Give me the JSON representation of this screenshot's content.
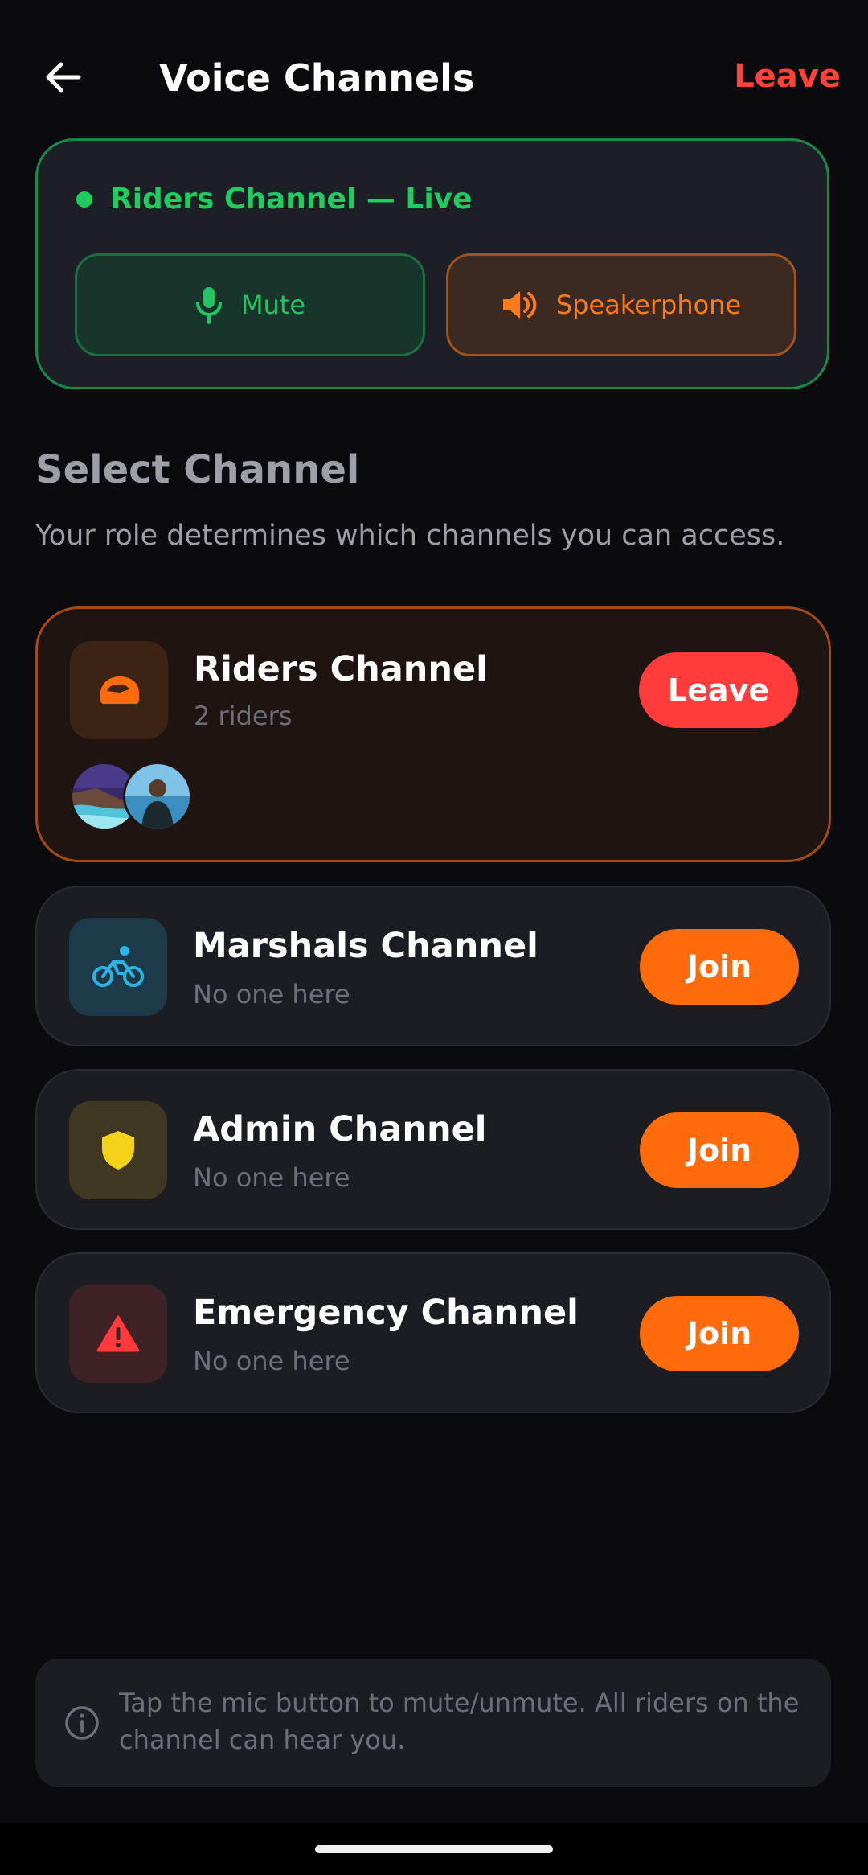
{
  "header": {
    "title": "Voice Channels",
    "leave_label": "Leave"
  },
  "live": {
    "status_text": "Riders Channel — Live",
    "mute_label": "Mute",
    "speaker_label": "Speakerphone"
  },
  "section": {
    "title": "Select Channel",
    "subtitle": "Your role determines which channels you can access."
  },
  "channels": [
    {
      "name": "Riders Channel",
      "sub": "2 riders",
      "button": "Leave",
      "icon": "helmet-icon",
      "active": true
    },
    {
      "name": "Marshals Channel",
      "sub": "No one here",
      "button": "Join",
      "icon": "bicycle-rider-icon",
      "active": false
    },
    {
      "name": "Admin Channel",
      "sub": "No one here",
      "button": "Join",
      "icon": "shield-icon",
      "active": false
    },
    {
      "name": "Emergency Channel",
      "sub": "No one here",
      "button": "Join",
      "icon": "warning-icon",
      "active": false
    }
  ],
  "info": {
    "text": "Tap the mic button to mute/unmute. All riders on the channel can hear you."
  },
  "colors": {
    "background": "#0b0b0f",
    "live_green": "#1fcc5e",
    "accent_orange": "#ff6b0a",
    "danger_red": "#ff3b3b",
    "marshals_blue": "#29b6e6",
    "admin_yellow": "#f5d21a"
  }
}
